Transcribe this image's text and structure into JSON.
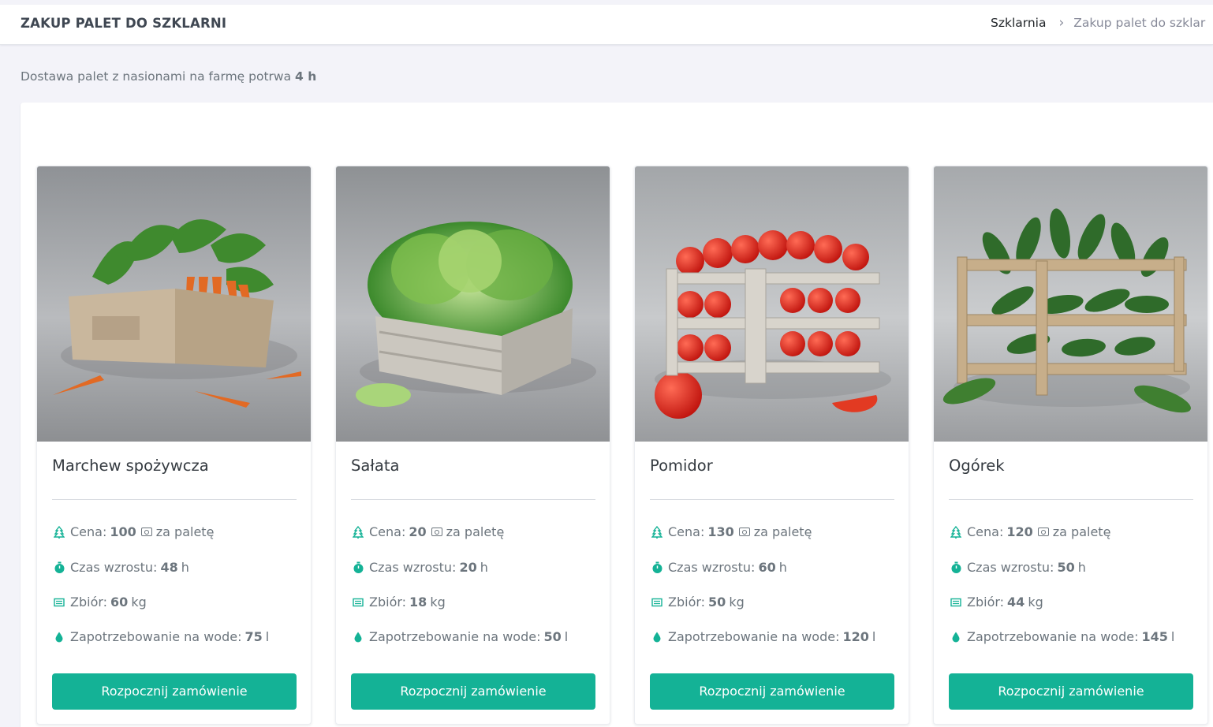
{
  "header": {
    "title": "ZAKUP PALET DO SZKLARNI",
    "breadcrumb": {
      "parent": "Szklarnia",
      "separator": "›",
      "current": "Zakup palet do szklar"
    }
  },
  "subtitle": {
    "text": "Dostawa palet z nasionami na farmę potrwa",
    "value": "4 h"
  },
  "labels": {
    "price": "Cena:",
    "price_suffix": "za paletę",
    "growth": "Czas wzrostu:",
    "yield": "Zbiór:",
    "water": "Zapotrzebowanie na wode:",
    "button": "Rozpocznij zamówienie"
  },
  "icons": {
    "price": "tree-icon",
    "growth": "stopwatch-icon",
    "yield": "crate-icon",
    "water": "water-drop-icon",
    "currency": "banknote-icon"
  },
  "colors": {
    "accent": "#14b296",
    "icon": "#14b296"
  },
  "products": [
    {
      "name": "Marchew spożywcza",
      "price": "100",
      "growth": "48",
      "growth_unit": "h",
      "yield": "60",
      "yield_unit": "kg",
      "water": "75",
      "water_unit": "l",
      "image": "carrot-crate-image"
    },
    {
      "name": "Sałata",
      "price": "20",
      "growth": "20",
      "growth_unit": "h",
      "yield": "18",
      "yield_unit": "kg",
      "water": "50",
      "water_unit": "l",
      "image": "lettuce-crate-image"
    },
    {
      "name": "Pomidor",
      "price": "130",
      "growth": "60",
      "growth_unit": "h",
      "yield": "50",
      "yield_unit": "kg",
      "water": "120",
      "water_unit": "l",
      "image": "tomato-crate-image"
    },
    {
      "name": "Ogórek",
      "price": "120",
      "growth": "50",
      "growth_unit": "h",
      "yield": "44",
      "yield_unit": "kg",
      "water": "145",
      "water_unit": "l",
      "image": "cucumber-crate-image"
    }
  ]
}
